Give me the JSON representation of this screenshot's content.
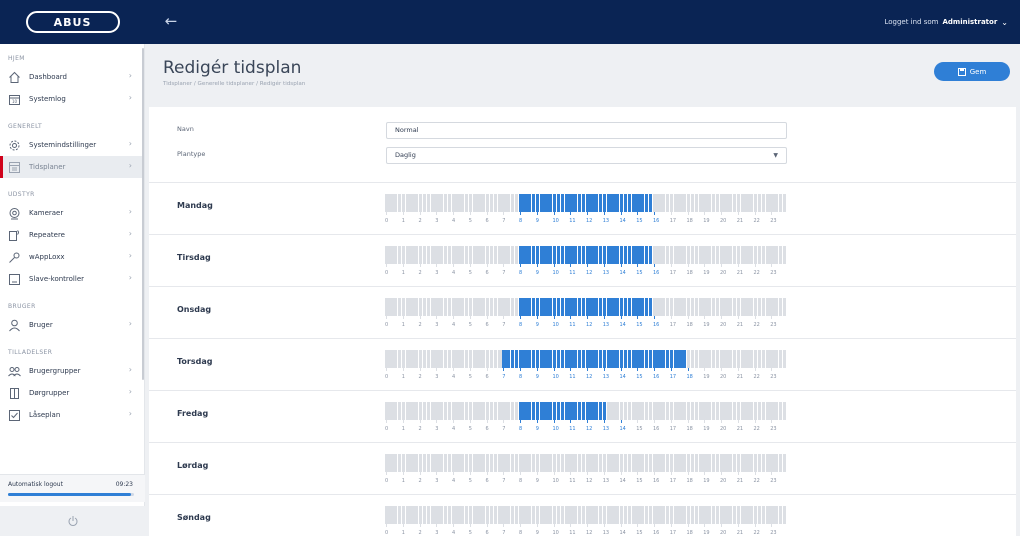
{
  "app": {
    "logo_text": "ABUS",
    "user_prefix": "Logget ind som",
    "user_name": "Administrator"
  },
  "sidebar": {
    "sections": [
      {
        "title": "HJEM",
        "items": [
          {
            "label": "Dashboard",
            "icon": "home-icon"
          },
          {
            "label": "Systemlog",
            "icon": "calendar-icon"
          }
        ]
      },
      {
        "title": "GENERELT",
        "items": [
          {
            "label": "Systemindstillinger",
            "icon": "gear-icon"
          },
          {
            "label": "Tidsplaner",
            "icon": "schedule-icon",
            "active": true
          }
        ]
      },
      {
        "title": "UDSTYR",
        "items": [
          {
            "label": "Kameraer",
            "icon": "camera-icon"
          },
          {
            "label": "Repeatere",
            "icon": "repeater-icon"
          },
          {
            "label": "wAppLoxx",
            "icon": "key-icon"
          },
          {
            "label": "Slave-kontroller",
            "icon": "controller-icon"
          }
        ]
      },
      {
        "title": "BRUGER",
        "items": [
          {
            "label": "Bruger",
            "icon": "user-icon"
          }
        ]
      },
      {
        "title": "TILLADELSER",
        "items": [
          {
            "label": "Brugergrupper",
            "icon": "user-group-icon"
          },
          {
            "label": "Dørgrupper",
            "icon": "door-group-icon"
          },
          {
            "label": "Låseplan",
            "icon": "lock-plan-icon"
          }
        ]
      }
    ],
    "logout_label": "Automatisk logout",
    "logout_time": "09:23",
    "logout_progress": 0.98
  },
  "page": {
    "title": "Redigér tidsplan",
    "breadcrumb": [
      "Tidsplaner",
      "Generelle tidsplaner",
      "Redigér tidsplan"
    ],
    "save_label": "Gem"
  },
  "form": {
    "name_label": "Navn",
    "name_value": "Normal",
    "plantype_label": "Plantype",
    "plantype_value": "Daglig"
  },
  "schedule": {
    "hour_labels": [
      "0",
      "1",
      "2",
      "3",
      "4",
      "5",
      "6",
      "7",
      "8",
      "9",
      "10",
      "11",
      "12",
      "13",
      "14",
      "15",
      "16",
      "17",
      "18",
      "19",
      "20",
      "21",
      "22",
      "23"
    ],
    "slots_per_hour": 4,
    "days": [
      {
        "name": "Mandag",
        "start": 8,
        "end": 16
      },
      {
        "name": "Tirsdag",
        "start": 8,
        "end": 16
      },
      {
        "name": "Onsdag",
        "start": 8,
        "end": 16
      },
      {
        "name": "Torsdag",
        "start": 7,
        "end": 18
      },
      {
        "name": "Fredag",
        "start": 8,
        "end": 13.25
      },
      {
        "name": "Lørdag",
        "start": null,
        "end": null
      },
      {
        "name": "Søndag",
        "start": null,
        "end": null
      }
    ]
  },
  "colors": {
    "topbar": "#0a2454",
    "accent": "#2f7fd6",
    "active_marker": "#d0021b",
    "slot_off": "#dcdfe4"
  }
}
